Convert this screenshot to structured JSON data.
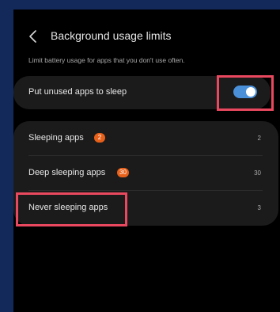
{
  "header": {
    "title": "Background usage limits",
    "back_icon": "chevron-left-icon"
  },
  "description": "Limit battery usage for apps that you don't use often.",
  "sleep_toggle": {
    "label": "Put unused apps to sleep",
    "state": "on",
    "color": "#4a90d8"
  },
  "app_lists": [
    {
      "label": "Sleeping apps",
      "badge": "2",
      "count": "2"
    },
    {
      "label": "Deep sleeping apps",
      "badge": "30",
      "count": "30"
    },
    {
      "label": "Never sleeping apps",
      "badge": "",
      "count": "3"
    }
  ],
  "colors": {
    "background": "#000000",
    "outer_frame": "#13295a",
    "badge": "#e8611a",
    "highlight": "#e9485f"
  }
}
